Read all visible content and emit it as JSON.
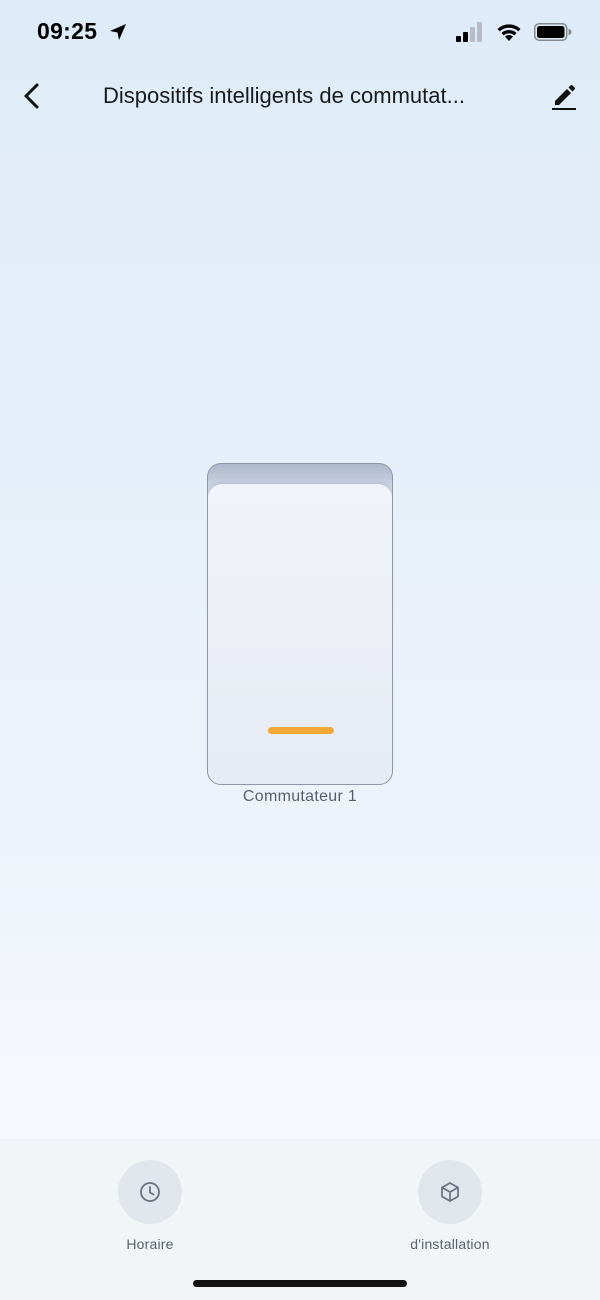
{
  "status_bar": {
    "time": "09:25"
  },
  "nav": {
    "title": "Dispositifs intelligents de commutat..."
  },
  "switch": {
    "label": "Commutateur 1",
    "indicator_color": "#f2a935"
  },
  "bottom_actions": [
    {
      "label": "Horaire",
      "icon": "clock-icon"
    },
    {
      "label": "d'installation",
      "icon": "cube-icon"
    }
  ],
  "colors": {
    "accent": "#f2a935",
    "icon_gray": "#6a7180"
  }
}
